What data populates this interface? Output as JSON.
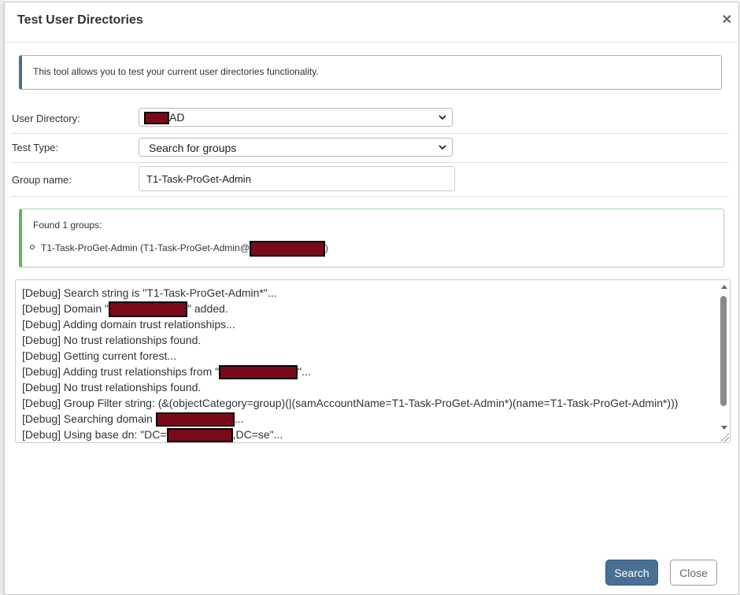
{
  "dialog": {
    "title": "Test User Directories",
    "close_icon": "close-icon"
  },
  "info": {
    "text": "This tool allows you to test your current user directories functionality."
  },
  "form": {
    "user_directory": {
      "label": "User Directory:",
      "value_suffix": "AD"
    },
    "test_type": {
      "label": "Test Type:",
      "value": "Search for groups"
    },
    "group_name": {
      "label": "Group name:",
      "value": "T1-Task-ProGet-Admin"
    }
  },
  "result": {
    "heading": "Found 1 groups:",
    "item_prefix": "T1-Task-ProGet-Admin (T1-Task-ProGet-Admin@",
    "item_suffix": ")"
  },
  "debug": {
    "l1": "[Debug] Search string is \"T1-Task-ProGet-Admin*\"...",
    "l2a": "[Debug] Domain \"",
    "l2b": "\" added.",
    "l3": "[Debug] Adding domain trust relationships...",
    "l4": "[Debug] No trust relationships found.",
    "l5": "[Debug] Getting current forest...",
    "l6a": "[Debug] Adding trust relationships from \"",
    "l6b": "\"...",
    "l7": "[Debug] No trust relationships found.",
    "l8": "[Debug] Group Filter string: (&(objectCategory=group)(|(samAccountName=T1-Task-ProGet-Admin*)(name=T1-Task-ProGet-Admin*)))",
    "l9a": "[Debug] Searching domain ",
    "l9b": "...",
    "l10a": "[Debug] Using base dn: \"DC=",
    "l10b": ",DC=se\"..."
  },
  "buttons": {
    "search": "Search",
    "close": "Close"
  },
  "colors": {
    "primary": "#4a6f94",
    "success_border": "#5cb85c",
    "redaction": "#7a0a1a"
  }
}
